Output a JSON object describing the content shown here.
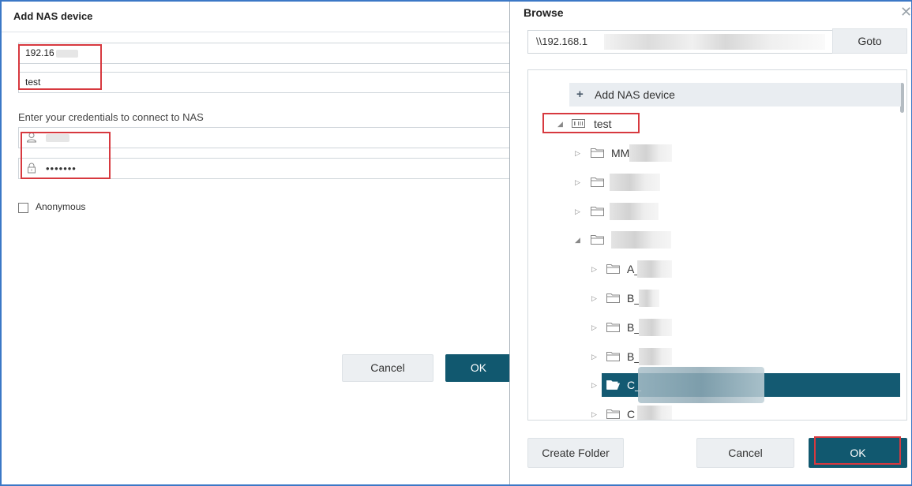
{
  "add_nas": {
    "title": "Add NAS device",
    "ip_value": "192.16",
    "name_value": "test",
    "creds_label": "Enter your credentials to connect to NAS",
    "password_value": "•••••••",
    "anonymous_label": "Anonymous",
    "cancel_label": "Cancel",
    "ok_label": "OK"
  },
  "browse": {
    "title": "Browse",
    "path_value": "\\\\192.168.1",
    "goto_label": "Goto",
    "add_nas_label": "Add NAS device",
    "tree": {
      "device_name": "test",
      "items": [
        {
          "name": "MM",
          "level": 1
        },
        {
          "name": "",
          "level": 1
        },
        {
          "name": "",
          "level": 1
        },
        {
          "name": "",
          "level": 1,
          "expanded": true
        },
        {
          "name": "A_",
          "level": 2
        },
        {
          "name": "B_",
          "level": 2
        },
        {
          "name": "B_",
          "level": 2
        },
        {
          "name": "B_",
          "level": 2
        },
        {
          "name": "C_",
          "level": 2,
          "selected": true
        },
        {
          "name": "C",
          "level": 2
        }
      ]
    },
    "create_folder_label": "Create Folder",
    "cancel_label": "Cancel",
    "ok_label": "OK"
  },
  "colors": {
    "primary": "#11586f",
    "highlight_box": "#d7393f",
    "frame": "#3b78c6"
  },
  "icons": {
    "user": "user-icon",
    "lock": "lock-icon",
    "folder": "folder-icon",
    "nas": "nas-device-icon",
    "close": "close-icon"
  }
}
